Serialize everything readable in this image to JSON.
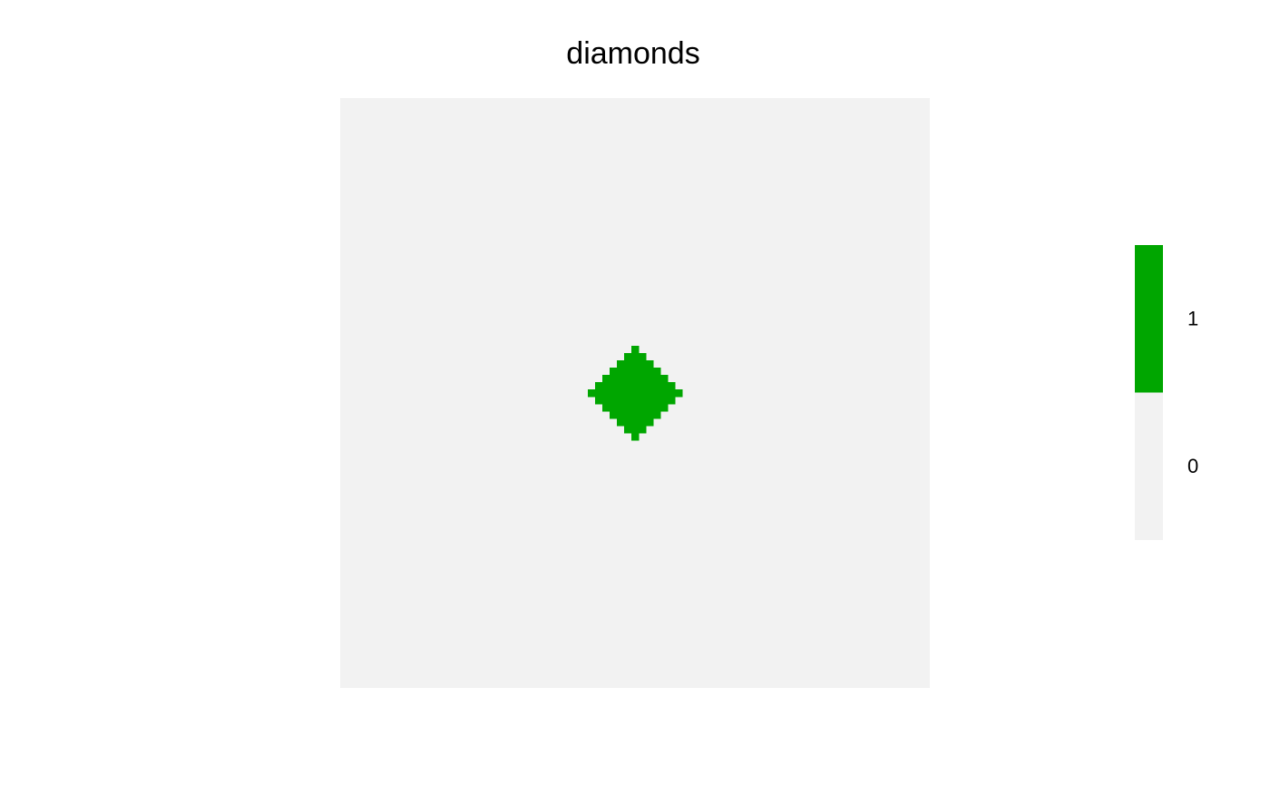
{
  "chart_data": {
    "type": "heatmap",
    "title": "diamonds",
    "xlabel": "",
    "ylabel": "",
    "grid": false,
    "matrix_size": [
      81,
      81
    ],
    "background_value": 0,
    "features": [
      {
        "shape": "diamond",
        "value": 1,
        "center": [
          41,
          41
        ],
        "radius": 6
      }
    ],
    "legend": {
      "placement": "right",
      "entries": [
        {
          "label": "1",
          "value": 1,
          "color": "#00A600"
        },
        {
          "label": "0",
          "value": 0,
          "color": "#F2F2F2"
        }
      ]
    },
    "colors": {
      "one": "#00A600",
      "zero": "#F2F2F2"
    }
  }
}
